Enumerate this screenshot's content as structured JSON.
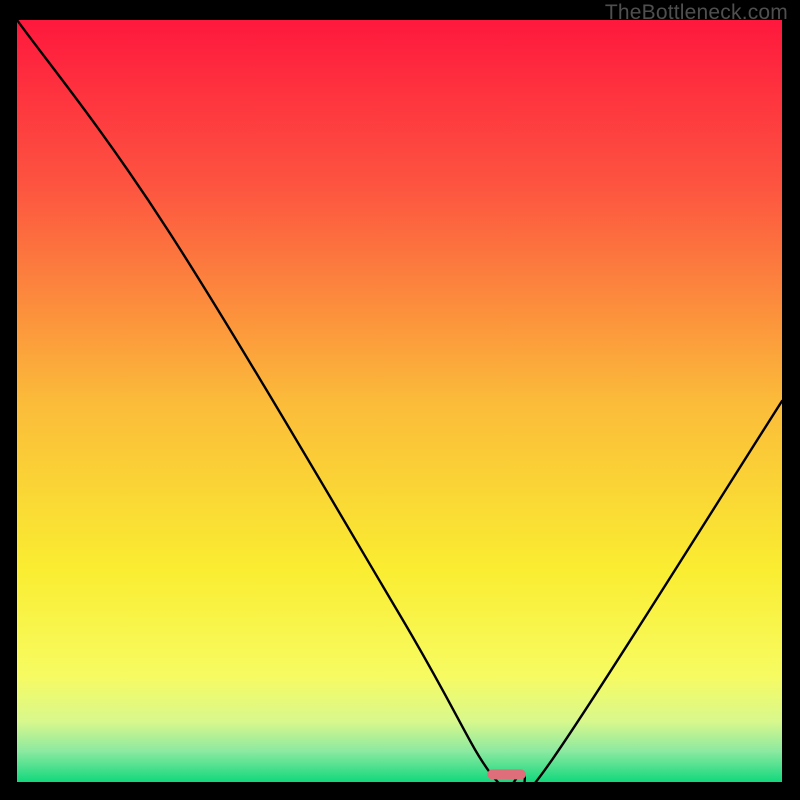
{
  "watermark": {
    "text": "TheBottleneck.com"
  },
  "chart_data": {
    "type": "line",
    "title": "",
    "xlabel": "",
    "ylabel": "",
    "xlim": [
      0,
      100
    ],
    "ylim": [
      0,
      100
    ],
    "grid": false,
    "legend": false,
    "series": [
      {
        "name": "bottleneck-curve",
        "x": [
          0,
          20,
          50,
          62,
          66,
          70,
          100
        ],
        "values": [
          100,
          72,
          22,
          1,
          1,
          3,
          50
        ]
      }
    ],
    "marker": {
      "name": "optimal-range",
      "x_range": [
        62,
        66
      ],
      "y": 1,
      "color": "#de6e79"
    },
    "background": {
      "type": "vertical-gradient",
      "stops": [
        {
          "pos": 0.0,
          "color": "#fe183d"
        },
        {
          "pos": 0.22,
          "color": "#fd5540"
        },
        {
          "pos": 0.5,
          "color": "#fbbb3a"
        },
        {
          "pos": 0.72,
          "color": "#faed31"
        },
        {
          "pos": 0.86,
          "color": "#f7fb61"
        },
        {
          "pos": 0.92,
          "color": "#d9f88c"
        },
        {
          "pos": 0.96,
          "color": "#8be9a0"
        },
        {
          "pos": 1.0,
          "color": "#12d87d"
        }
      ]
    }
  }
}
